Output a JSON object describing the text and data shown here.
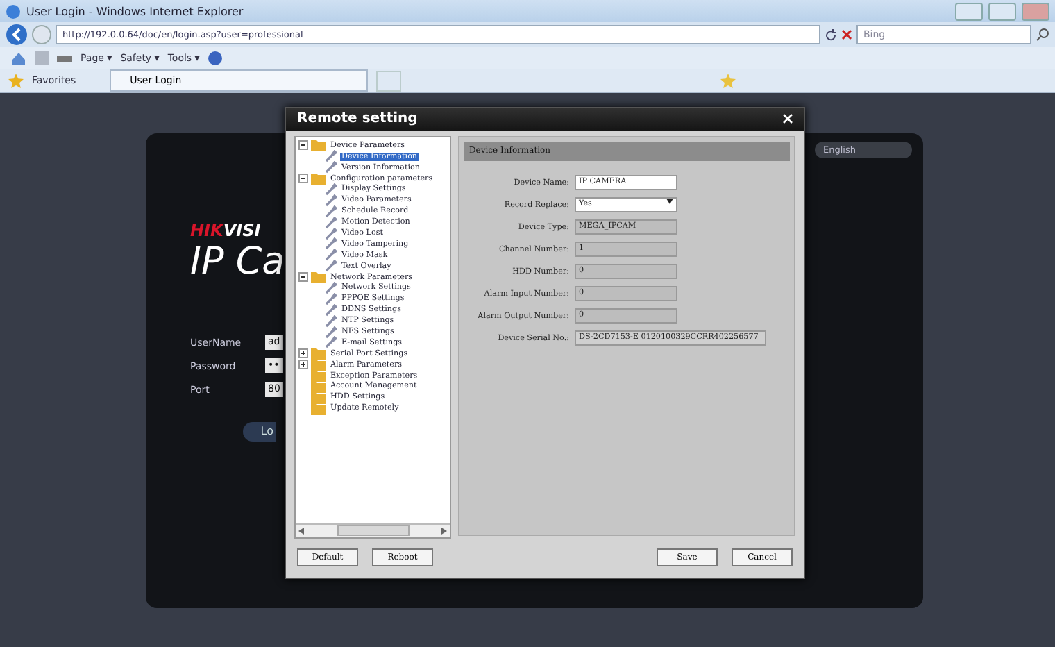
{
  "window": {
    "title": "User Login - Windows Internet Explorer"
  },
  "address_bar": {
    "url": "http://192.0.0.64/doc/en/login.asp?user=professional",
    "search_placeholder": "Bing"
  },
  "command_bar": [
    "Page ▾",
    "Safety ▾",
    "Tools ▾"
  ],
  "favorites_bar": {
    "favorites": "Favorites",
    "tab": "User Login"
  },
  "login_page": {
    "language": "English",
    "brand_part_1": "HIK",
    "brand_part_2": "VISI",
    "product_title": "IP Ca",
    "fields": [
      {
        "label": "UserName",
        "value": "ad"
      },
      {
        "label": "Password",
        "value": "••"
      },
      {
        "label": "Port",
        "value": "80"
      }
    ],
    "login_button": "Lo"
  },
  "dialog": {
    "title": "Remote setting",
    "tree": [
      {
        "label": "Device Parameters",
        "kind": "folder",
        "expanded": true,
        "children": [
          {
            "label": "Device Information",
            "kind": "leaf",
            "selected": true
          },
          {
            "label": "Version Information",
            "kind": "leaf",
            "selected": false
          }
        ]
      },
      {
        "label": "Configuration parameters",
        "kind": "folder",
        "expanded": true,
        "children": [
          {
            "label": "Display Settings",
            "kind": "leaf",
            "selected": false
          },
          {
            "label": "Video Parameters",
            "kind": "leaf",
            "selected": false
          },
          {
            "label": "Schedule Record",
            "kind": "leaf",
            "selected": false
          },
          {
            "label": "Motion Detection",
            "kind": "leaf",
            "selected": false
          },
          {
            "label": "Video Lost",
            "kind": "leaf",
            "selected": false
          },
          {
            "label": "Video Tampering",
            "kind": "leaf",
            "selected": false
          },
          {
            "label": "Video Mask",
            "kind": "leaf",
            "selected": false
          },
          {
            "label": "Text Overlay",
            "kind": "leaf",
            "selected": false
          }
        ]
      },
      {
        "label": "Network Parameters",
        "kind": "folder",
        "expanded": true,
        "children": [
          {
            "label": "Network Settings",
            "kind": "leaf",
            "selected": false
          },
          {
            "label": "PPPOE Settings",
            "kind": "leaf",
            "selected": false
          },
          {
            "label": "DDNS Settings",
            "kind": "leaf",
            "selected": false
          },
          {
            "label": "NTP Settings",
            "kind": "leaf",
            "selected": false
          },
          {
            "label": "NFS Settings",
            "kind": "leaf",
            "selected": false
          },
          {
            "label": "E-mail Settings",
            "kind": "leaf",
            "selected": false
          }
        ]
      },
      {
        "label": "Serial Port Settings",
        "kind": "folder",
        "expanded": false
      },
      {
        "label": "Alarm Parameters",
        "kind": "folder",
        "expanded": false
      },
      {
        "label": "Exception Parameters",
        "kind": "folder"
      },
      {
        "label": "Account Management",
        "kind": "folder"
      },
      {
        "label": "HDD Settings",
        "kind": "folder"
      },
      {
        "label": "Update Remotely",
        "kind": "folder"
      }
    ],
    "panel_title": "Device Information",
    "fields": [
      {
        "label": "Device Name:",
        "value": "IP CAMERA",
        "kind": "text"
      },
      {
        "label": "Record Replace:",
        "value": "Yes",
        "kind": "select"
      },
      {
        "label": "Device Type:",
        "value": "MEGA_IPCAM",
        "kind": "readonly"
      },
      {
        "label": "Channel Number:",
        "value": "1",
        "kind": "readonly"
      },
      {
        "label": "HDD Number:",
        "value": "0",
        "kind": "readonly"
      },
      {
        "label": "Alarm Input Number:",
        "value": "0",
        "kind": "readonly"
      },
      {
        "label": "Alarm Output Number:",
        "value": "0",
        "kind": "readonly"
      },
      {
        "label": "Device Serial No.:",
        "value": "DS-2CD7153-E 0120100329CCRR402256577",
        "kind": "serial"
      }
    ],
    "left_buttons": [
      "Default",
      "Reboot"
    ],
    "right_buttons": [
      "Save",
      "Cancel"
    ]
  }
}
